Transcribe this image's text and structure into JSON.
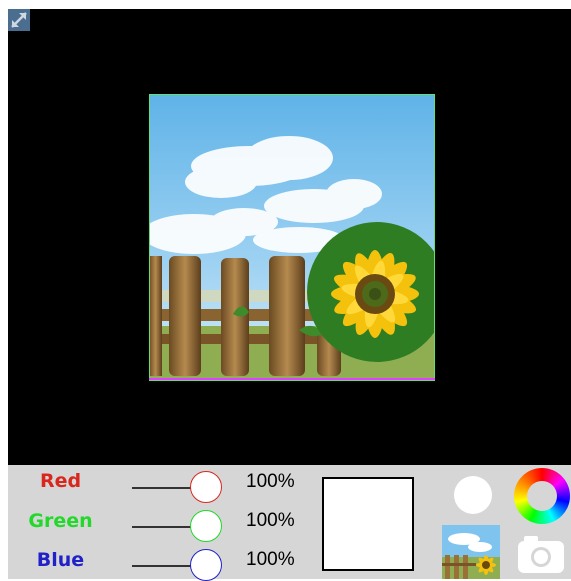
{
  "channels": [
    {
      "label": "Red",
      "percent_text": "100%",
      "value": 1.0,
      "color": "#d8281e"
    },
    {
      "label": "Green",
      "percent_text": "100%",
      "value": 1.0,
      "color": "#22d82a"
    },
    {
      "label": "Blue",
      "percent_text": "100%",
      "value": 1.0,
      "color": "#2022c8"
    }
  ],
  "icons": {
    "expand": "expand-arrows-icon",
    "color_wheel": "color-wheel-icon",
    "camera": "camera-icon",
    "color_dot": "white-circle"
  },
  "colors": {
    "viewer_bg": "#000000",
    "controls_bg": "#d6d6d6",
    "preview_fill": "#ffffff"
  }
}
